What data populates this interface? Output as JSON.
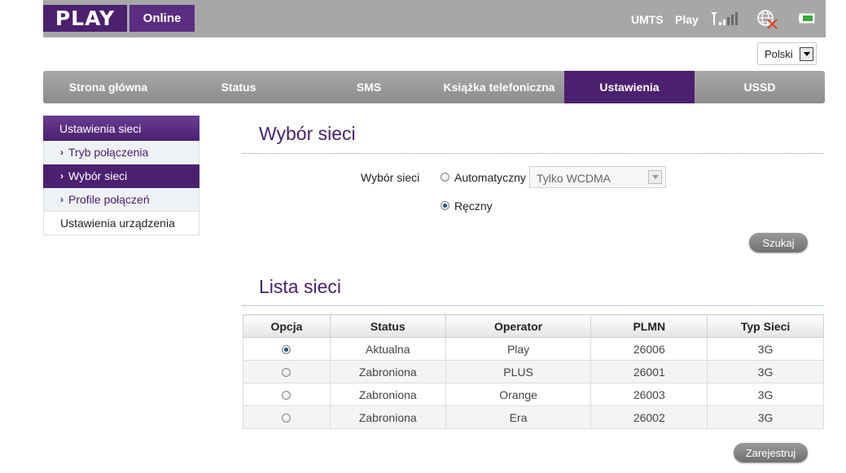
{
  "header": {
    "logo": "PLAY",
    "logo_sub": "Online",
    "network_type": "UMTS",
    "operator": "Play"
  },
  "language": {
    "selected": "Polski"
  },
  "nav": {
    "items": [
      {
        "label": "Strona główna",
        "active": false
      },
      {
        "label": "Status",
        "active": false
      },
      {
        "label": "SMS",
        "active": false
      },
      {
        "label": "Książka telefoniczna",
        "active": false
      },
      {
        "label": "Ustawienia",
        "active": true
      },
      {
        "label": "USSD",
        "active": false
      }
    ]
  },
  "sidebar": {
    "header": "Ustawienia sieci",
    "items": [
      {
        "label": "Tryb połączenia",
        "active": false
      },
      {
        "label": "Wybór sieci",
        "active": true
      },
      {
        "label": "Profile połączeń",
        "active": false
      }
    ],
    "other": "Ustawienia urządzenia"
  },
  "network_selection": {
    "title": "Wybór sieci",
    "field_label": "Wybór sieci",
    "option_auto": "Automatyczny",
    "option_manual": "Ręczny",
    "selected": "manual",
    "mode_select": "Tylko WCDMA",
    "search_button": "Szukaj"
  },
  "network_list": {
    "title": "Lista sieci",
    "columns": [
      "Opcja",
      "Status",
      "Operator",
      "PLMN",
      "Typ Sieci"
    ],
    "rows": [
      {
        "selected": true,
        "status": "Aktualna",
        "operator": "Play",
        "plmn": "26006",
        "type": "3G"
      },
      {
        "selected": false,
        "status": "Zabroniona",
        "operator": "PLUS",
        "plmn": "26001",
        "type": "3G"
      },
      {
        "selected": false,
        "status": "Zabroniona",
        "operator": "Orange",
        "plmn": "26003",
        "type": "3G"
      },
      {
        "selected": false,
        "status": "Zabroniona",
        "operator": "Era",
        "plmn": "26002",
        "type": "3G"
      }
    ],
    "register_button": "Zarejestruj"
  },
  "colors": {
    "brand_purple": "#4b206e",
    "header_gray": "#a7a7a7",
    "nav_gray": "#8c8c8c"
  },
  "icons": [
    "signal-icon",
    "globe-disconnected-icon",
    "battery-icon"
  ]
}
